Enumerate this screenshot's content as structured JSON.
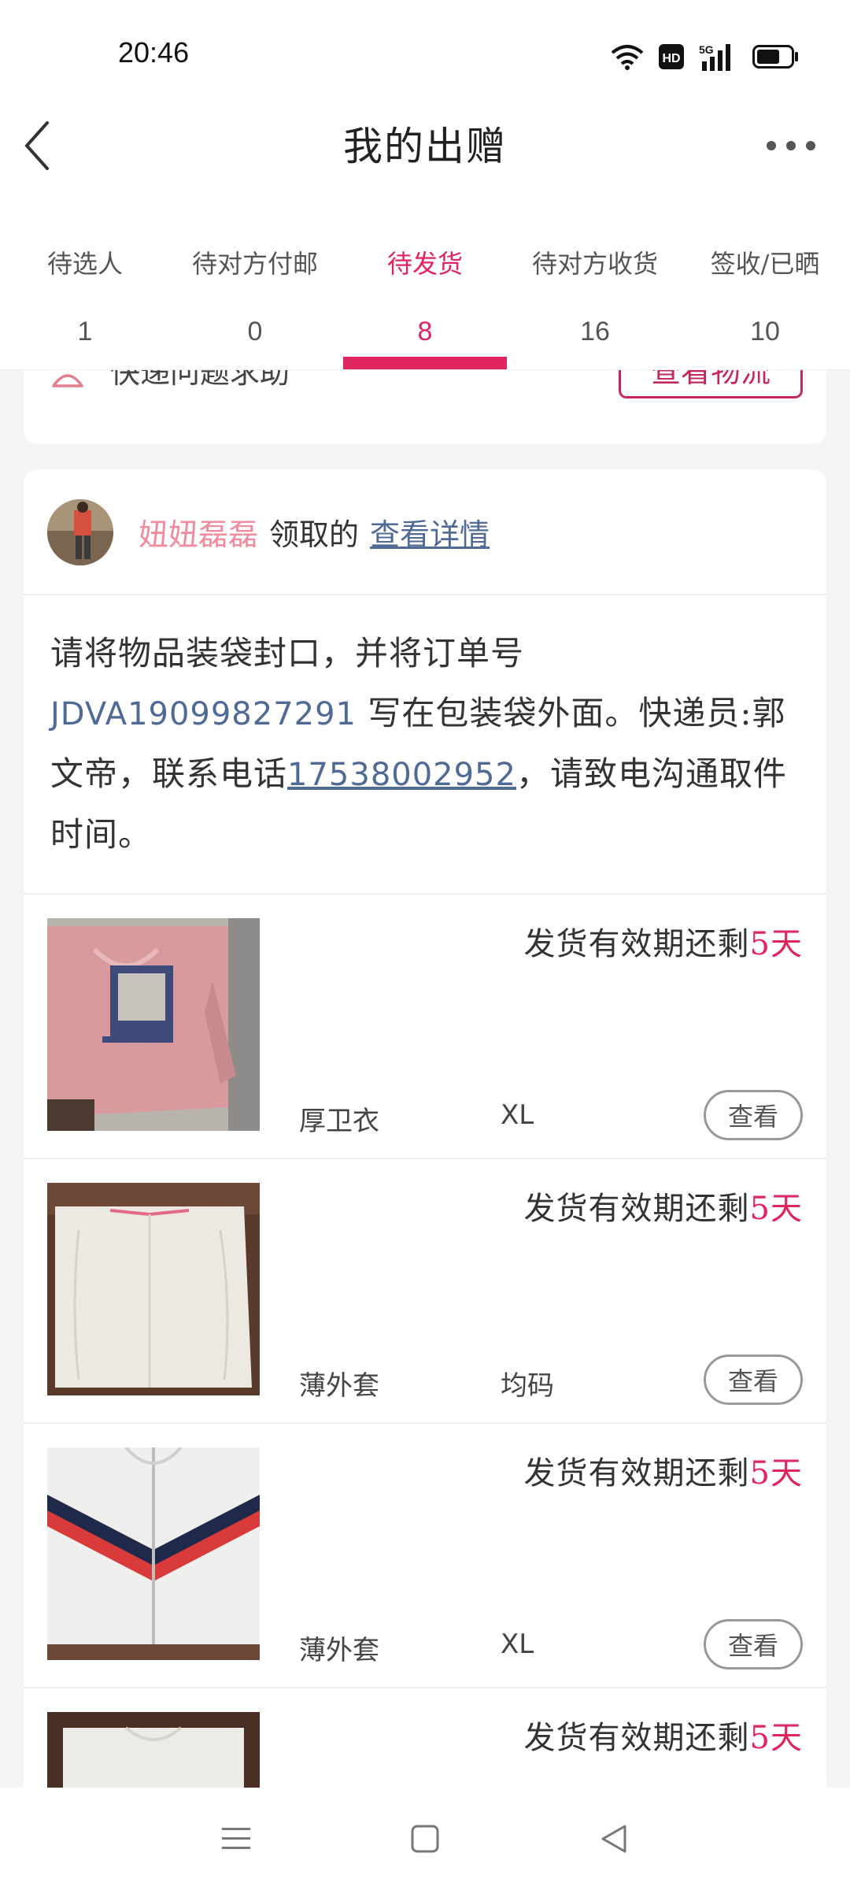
{
  "status_bar": {
    "time": "20:46",
    "hd_label": "HD",
    "network": "5G",
    "icons": [
      "wifi-icon",
      "hd-icon",
      "signal-5g-icon",
      "battery-icon"
    ]
  },
  "header": {
    "title": "我的出赠",
    "back_icon": "chevron-left-icon",
    "more_icon": "more-dots-icon"
  },
  "tabs": [
    {
      "label": "待选人",
      "count": "1",
      "active": false
    },
    {
      "label": "待对方付邮",
      "count": "0",
      "active": false
    },
    {
      "label": "待发货",
      "count": "8",
      "active": true
    },
    {
      "label": "待对方收货",
      "count": "16",
      "active": false
    },
    {
      "label": "签收/已晒",
      "count": "10",
      "active": false
    }
  ],
  "top_card": {
    "help_text": "快递问题求助",
    "logistics_button": "查看物流"
  },
  "order": {
    "receiver_name": "妞妞磊磊",
    "receiver_suffix": "领取的",
    "view_detail": "查看详情",
    "instr_part1": "请将物品装袋封口，并将订单号 ",
    "order_number": "JDVA19099827291",
    "instr_part2": " 写在包装袋外面。快递员:郭文帝，联系电话",
    "phone": "17538002952",
    "instr_part3": "，请致电沟通取件时间。",
    "items": [
      {
        "deadline_prefix": "发货有效期还剩",
        "deadline_days": "5天",
        "name": "厚卫衣",
        "size": "XL",
        "view_label": "查看",
        "thumb": "pink-hoodie"
      },
      {
        "deadline_prefix": "发货有效期还剩",
        "deadline_days": "5天",
        "name": "薄外套",
        "size": "均码",
        "view_label": "查看",
        "thumb": "white-cardigan"
      },
      {
        "deadline_prefix": "发货有效期还剩",
        "deadline_days": "5天",
        "name": "薄外套",
        "size": "XL",
        "view_label": "查看",
        "thumb": "striped-jacket"
      },
      {
        "deadline_prefix": "发货有效期还剩",
        "deadline_days": "5天",
        "name": "",
        "size": "",
        "view_label": "",
        "thumb": "white-shirt"
      }
    ]
  },
  "colors": {
    "accent": "#e0245e",
    "link": "#4f6a94",
    "button_border": "#c2285c"
  }
}
